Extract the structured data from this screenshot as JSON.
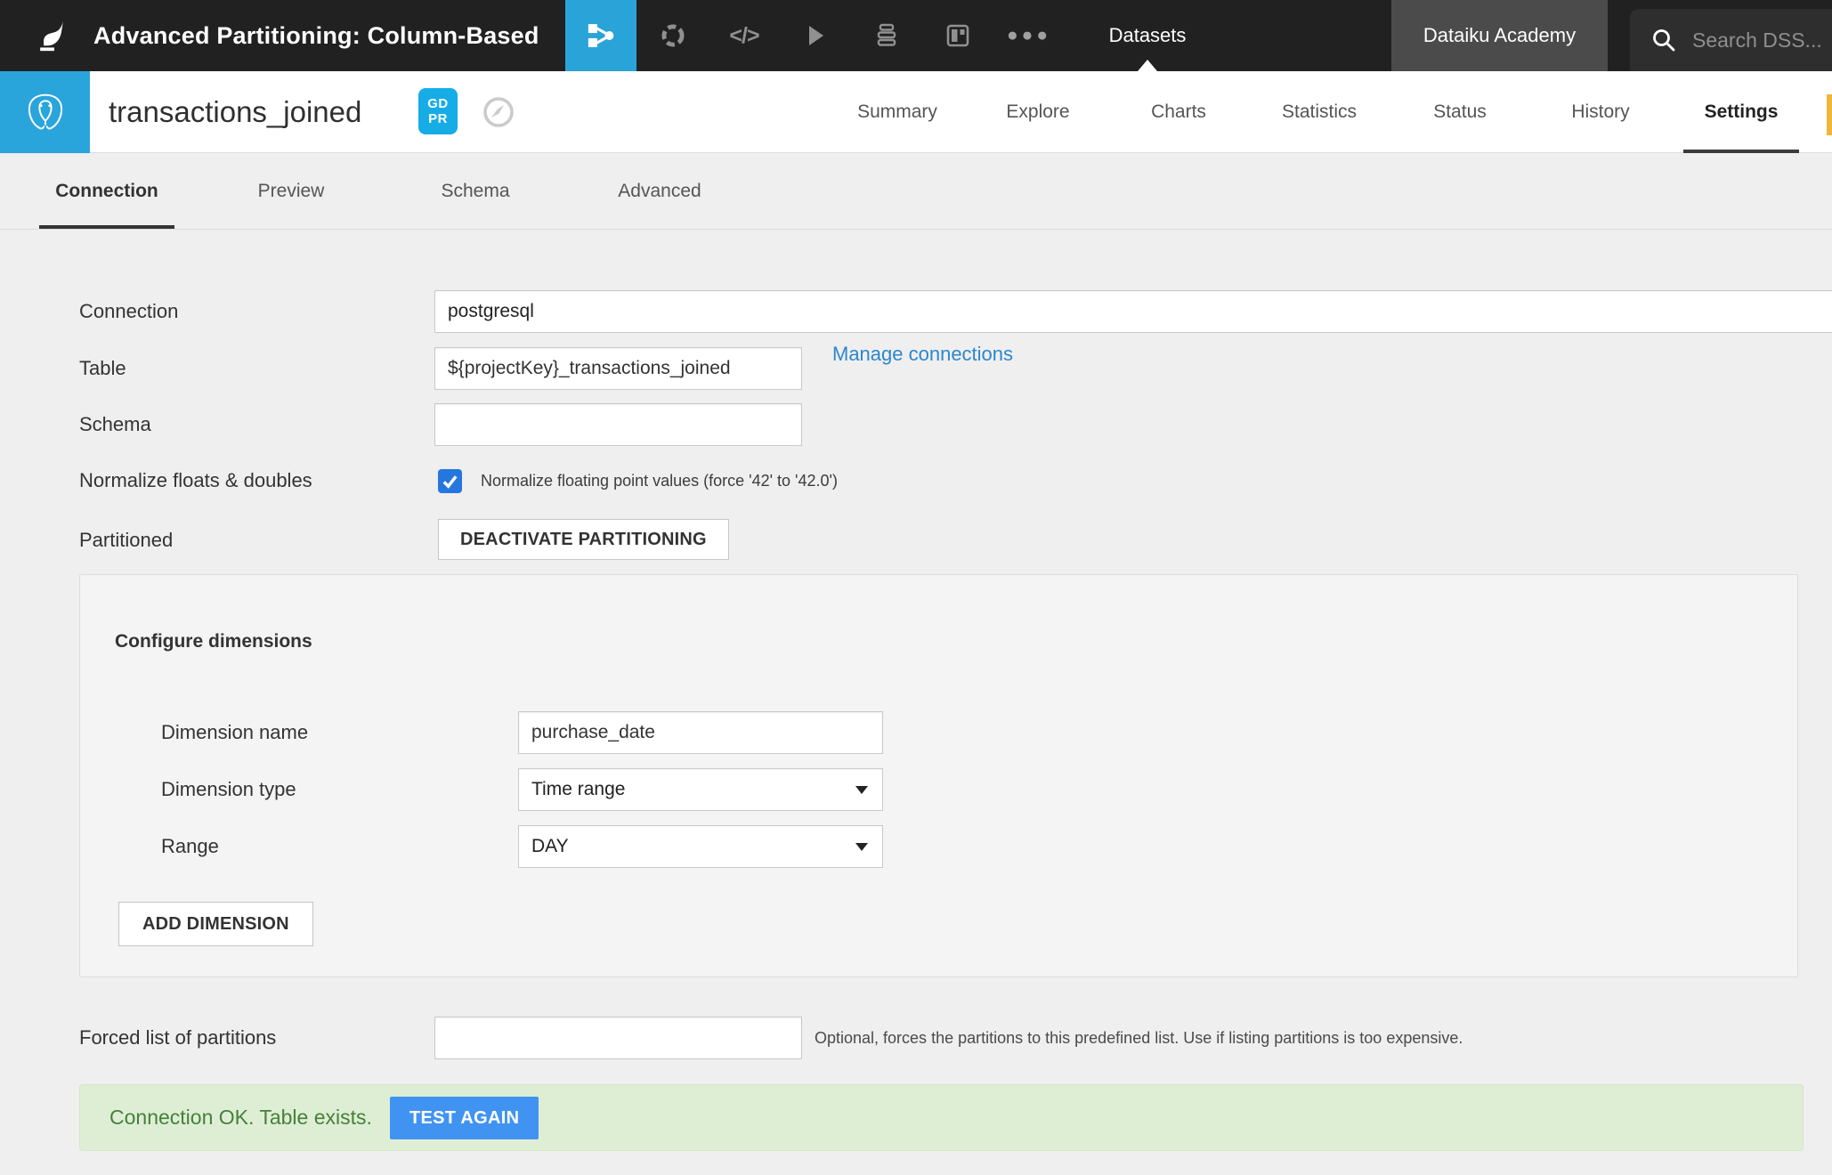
{
  "navbar": {
    "title": "Advanced Partitioning: Column-Based",
    "section": "Datasets",
    "academy_label": "Dataiku Academy",
    "search_placeholder": "Search DSS...",
    "icons": [
      "dataiku-bird-logo",
      "flow-icon",
      "lab-rotor-icon",
      "code-icon",
      "play-icon",
      "jobs-stack-icon",
      "dashboard-icon",
      "more-ellipsis-icon",
      "search-icon"
    ]
  },
  "header": {
    "dataset_name": "transactions_joined",
    "gdpr_line1": "GD",
    "gdpr_line2": "PR",
    "type_icon": "postgresql-elephant-icon",
    "tabs": [
      {
        "label": "Summary",
        "active": false
      },
      {
        "label": "Explore",
        "active": false
      },
      {
        "label": "Charts",
        "active": false
      },
      {
        "label": "Statistics",
        "active": false
      },
      {
        "label": "Status",
        "active": false
      },
      {
        "label": "History",
        "active": false
      },
      {
        "label": "Settings",
        "active": true
      }
    ]
  },
  "subtabs": [
    {
      "label": "Connection",
      "active": true
    },
    {
      "label": "Preview",
      "active": false
    },
    {
      "label": "Schema",
      "active": false
    },
    {
      "label": "Advanced",
      "active": false
    }
  ],
  "form": {
    "connection": {
      "label": "Connection",
      "value": "postgresql"
    },
    "manage_link": "Manage connections",
    "table": {
      "label": "Table",
      "value": "${projectKey}_transactions_joined"
    },
    "schema": {
      "label": "Schema",
      "value": ""
    },
    "normalize": {
      "label": "Normalize floats & doubles",
      "checked": true,
      "text": "Normalize floating point values (force '42' to '42.0')"
    },
    "partitioned": {
      "label": "Partitioned",
      "button": "DEACTIVATE PARTITIONING"
    }
  },
  "dimensions": {
    "heading": "Configure dimensions",
    "name": {
      "label": "Dimension name",
      "value": "purchase_date"
    },
    "type": {
      "label": "Dimension type",
      "value": "Time range"
    },
    "range": {
      "label": "Range",
      "value": "DAY"
    },
    "add_button": "ADD DIMENSION"
  },
  "forced_list": {
    "label": "Forced list of partitions",
    "value": "",
    "hint": "Optional, forces the partitions to this predefined list. Use if listing partitions is too expensive."
  },
  "status": {
    "message": "Connection OK. Table exists.",
    "button": "TEST AGAIN"
  },
  "colors": {
    "navbar_bg": "#212121",
    "accent_blue": "#2aa4d8",
    "gdpr_blue": "#16ace6",
    "link_blue": "#2b87ce",
    "checkbox_blue": "#2577df",
    "test_button_blue": "#4193f2",
    "success_bg": "#deeed4",
    "success_text": "#45803c",
    "panel_handle_yellow": "#efb63c"
  }
}
